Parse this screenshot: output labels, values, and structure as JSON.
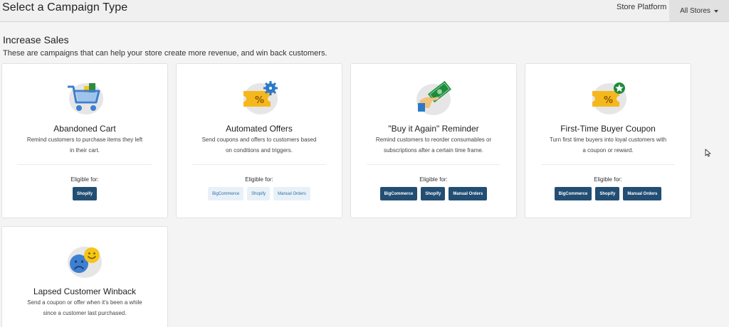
{
  "header": {
    "title": "Select a Campaign Type",
    "store_platform_label": "Store Platform",
    "store_select": "All Stores"
  },
  "section": {
    "title": "Increase Sales",
    "description": "These are campaigns that can help your store create more revenue, and win back customers."
  },
  "eligible_label": "Eligible for:",
  "cards": [
    {
      "title": "Abandoned Cart",
      "desc_line1": "Remind customers to purchase items they left",
      "desc_line2": "in their cart.",
      "icon": "shopping-cart-icon",
      "badges": [
        "Shopify"
      ]
    },
    {
      "title": "Automated Offers",
      "desc_line1": "Send coupons and offers to customers based",
      "desc_line2": "on conditions and triggers.",
      "icon": "coupon-gear-icon",
      "badges": [
        "BigCommerce",
        "Shopify",
        "Manual Orders"
      ]
    },
    {
      "title": "\"Buy it Again\" Reminder",
      "desc_line1": "Remind customers to reorder consumables or",
      "desc_line2": "subscriptions after a certain time frame.",
      "icon": "cash-hand-icon",
      "badges": [
        "BigCommerce",
        "Shopify",
        "Manual Orders"
      ]
    },
    {
      "title": "First-Time Buyer Coupon",
      "desc_line1": "Turn first time buyers into loyal customers with",
      "desc_line2": "a coupon or reward.",
      "icon": "coupon-star-icon",
      "badges": [
        "BigCommerce",
        "Shopify",
        "Manual Orders"
      ]
    },
    {
      "title": "Lapsed Customer Winback",
      "desc_line1": "Send a coupon or offer when it's been a while",
      "desc_line2": "since a customer last purchased.",
      "icon": "sad-happy-faces-icon",
      "badges": []
    }
  ],
  "colors": {
    "badge_dark": "#234e73",
    "badge_light_bg": "#e9f1f8",
    "badge_light_text": "#2f6ea4",
    "coupon_yellow": "#f5b81c",
    "gear_blue": "#2b79c9"
  }
}
